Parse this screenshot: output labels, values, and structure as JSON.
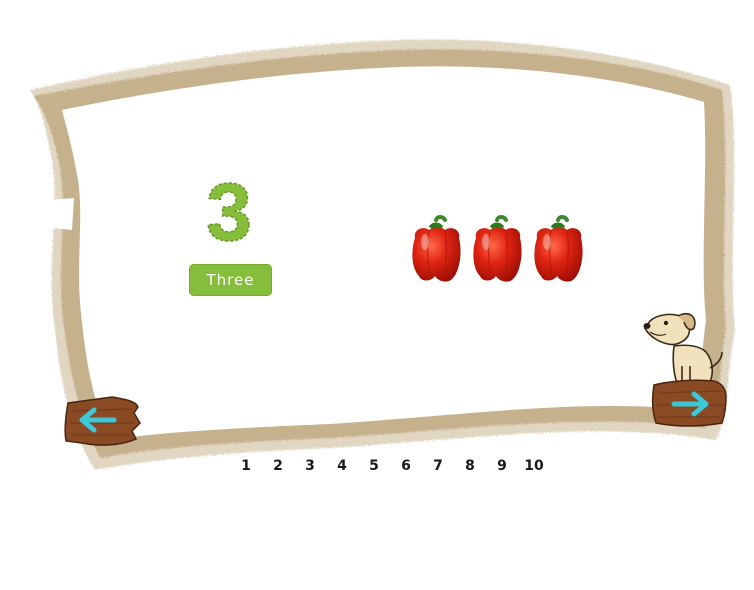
{
  "lesson": {
    "numeral": "3",
    "word": "Three",
    "object_name": "red-bell-pepper",
    "object_count": 3,
    "numeral_color": "#86bd3a",
    "badge_color": "#86bd3a"
  },
  "navigation": {
    "prev_icon": "left-arrow-icon",
    "next_icon": "right-arrow-icon",
    "arrow_color": "#3cc8d8",
    "wood_color": "#8a4a24"
  },
  "pages": [
    "1",
    "2",
    "3",
    "4",
    "5",
    "6",
    "7",
    "8",
    "9",
    "10"
  ],
  "mascot": {
    "icon": "dog-mascot-icon"
  }
}
